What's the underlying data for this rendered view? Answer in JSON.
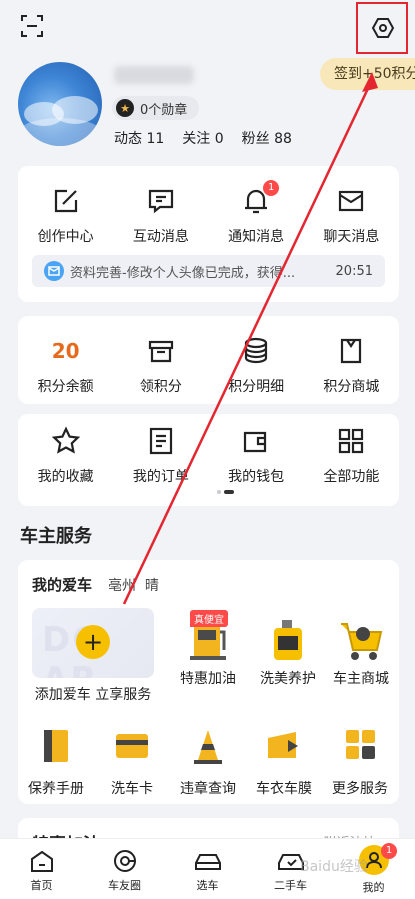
{
  "header": {
    "scan_icon": "scan-icon",
    "settings_icon": "settings-icon",
    "signin_label": "签到+50积分"
  },
  "profile": {
    "medal_label": "0个勋章",
    "stats": [
      {
        "label": "动态",
        "value": "11"
      },
      {
        "label": "关注",
        "value": "0"
      },
      {
        "label": "粉丝",
        "value": "88"
      }
    ]
  },
  "messages": {
    "items": [
      {
        "label": "创作中心",
        "icon": "edit-icon"
      },
      {
        "label": "互动消息",
        "icon": "comment-icon"
      },
      {
        "label": "通知消息",
        "icon": "bell-icon",
        "badge": "1"
      },
      {
        "label": "聊天消息",
        "icon": "mail-icon"
      }
    ],
    "notice_text": "资料完善-修改个人头像已完成，获得...",
    "notice_time": "20:51"
  },
  "points": {
    "balance_value": "20",
    "balance_label": "积分余额",
    "items": [
      {
        "label": "领积分",
        "icon": "gift-box-icon"
      },
      {
        "label": "积分明细",
        "icon": "coin-stack-icon"
      },
      {
        "label": "积分商城",
        "icon": "shopping-bag-icon"
      }
    ]
  },
  "shortcuts": {
    "items": [
      {
        "label": "我的收藏",
        "icon": "star-icon"
      },
      {
        "label": "我的订单",
        "icon": "order-icon"
      },
      {
        "label": "我的钱包",
        "icon": "wallet-icon"
      },
      {
        "label": "全部功能",
        "icon": "grid-icon"
      }
    ]
  },
  "services_title": "车主服务",
  "my_car": {
    "title": "我的爱车",
    "city": "亳州",
    "weather": "晴",
    "add_label": "添加爱车 立享服务",
    "row1": [
      {
        "label": "特惠加油",
        "icon": "fuel-pump-icon",
        "tag": "真便宜"
      },
      {
        "label": "洗美养护",
        "icon": "oil-can-icon"
      },
      {
        "label": "车主商城",
        "icon": "shopping-cart-icon"
      }
    ],
    "row2": [
      {
        "label": "保养手册",
        "icon": "manual-icon"
      },
      {
        "label": "洗车卡",
        "icon": "card-icon"
      },
      {
        "label": "违章查询",
        "icon": "traffic-cone-icon"
      },
      {
        "label": "车衣车膜",
        "icon": "car-film-icon"
      },
      {
        "label": "更多服务",
        "icon": "more-grid-icon"
      }
    ]
  },
  "deals": {
    "title": "特惠加油",
    "nearby": "附近油站 ›"
  },
  "tabbar": {
    "items": [
      {
        "label": "首页",
        "icon": "home-icon"
      },
      {
        "label": "车友圈",
        "icon": "circle-icon"
      },
      {
        "label": "选车",
        "icon": "car-icon"
      },
      {
        "label": "二手车",
        "icon": "used-car-icon"
      },
      {
        "label": "我的",
        "icon": "user-icon",
        "badge": "1"
      }
    ]
  },
  "watermark": "Baidu经验",
  "colors": {
    "accent_yellow": "#f6c000",
    "annotation_red": "#e3262f",
    "points_orange": "#e56a1e"
  }
}
